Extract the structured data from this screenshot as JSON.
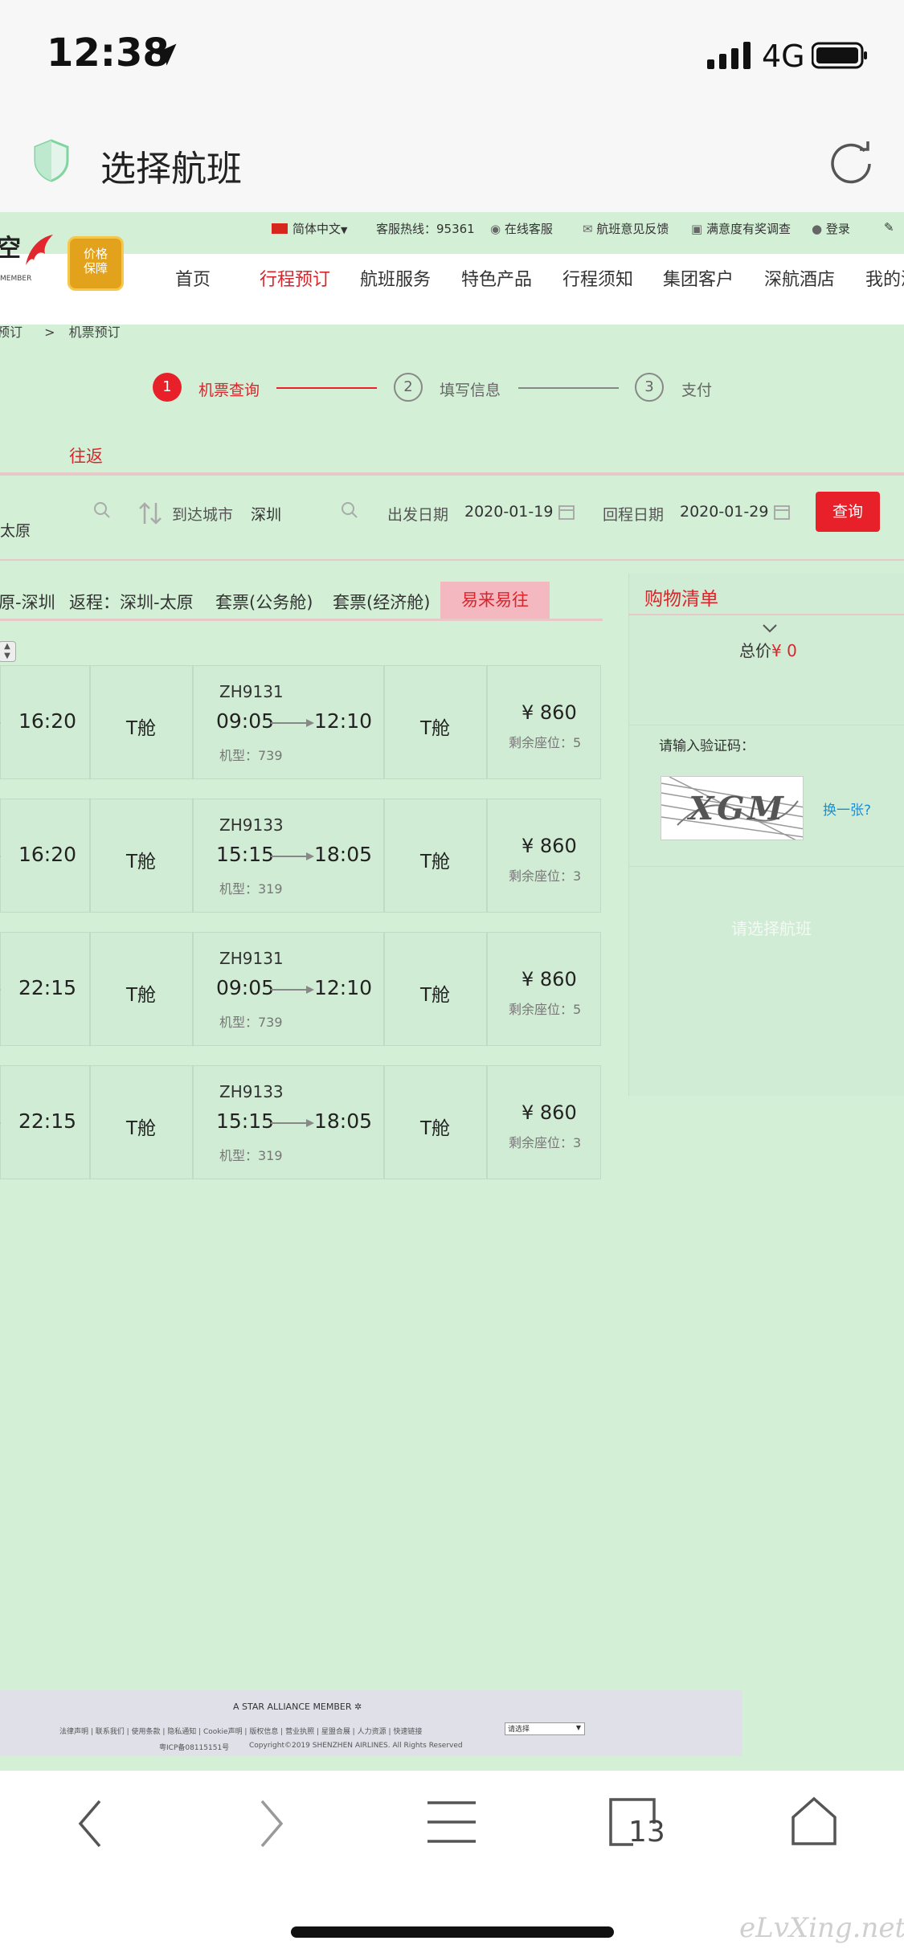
{
  "status_bar": {
    "time": "12:38",
    "network": "4G"
  },
  "browser": {
    "title": "选择航班"
  },
  "topbar": {
    "language": "简体中文",
    "hotline": "客服热线：95361",
    "online_service": "在线客服",
    "feedback": "航班意见反馈",
    "survey": "满意度有奖调查",
    "login": "登录"
  },
  "logo": {
    "partial_text": "空",
    "tag": "MEMBER",
    "badge": "价格\n保障"
  },
  "nav": [
    "首页",
    "行程预订",
    "航班服务",
    "特色产品",
    "行程须知",
    "集团客户",
    "深航酒店",
    "我的深"
  ],
  "breadcrumb": {
    "prev": "预订",
    "sep": ">",
    "current": "机票预订"
  },
  "steps": [
    {
      "num": "1",
      "label": "机票查询"
    },
    {
      "num": "2",
      "label": "填写信息"
    },
    {
      "num": "3",
      "label": "支付"
    }
  ],
  "trip_type": "往返",
  "search": {
    "from_city": "太原",
    "to_label": "到达城市",
    "to_city": "深圳",
    "depart_label": "出发日期",
    "depart_date": "2020-01-19",
    "return_label": "回程日期",
    "return_date": "2020-01-29",
    "search_button": "查询"
  },
  "tabs": [
    "原-深圳",
    "返程：深圳-太原",
    "套票(公务舱)",
    "套票(经济舱)",
    "易来易往"
  ],
  "flights": [
    {
      "prev_time": "16:20",
      "prev_cabin": "T舱",
      "flight_no": "ZH9131",
      "dep": "09:05",
      "arr": "12:10",
      "aircraft": "机型：739",
      "cabin": "T舱",
      "price": "¥ 860",
      "seats": "剩余座位：5"
    },
    {
      "prev_time": "16:20",
      "prev_cabin": "T舱",
      "flight_no": "ZH9133",
      "dep": "15:15",
      "arr": "18:05",
      "aircraft": "机型：319",
      "cabin": "T舱",
      "price": "¥ 860",
      "seats": "剩余座位：3"
    },
    {
      "prev_time": "22:15",
      "prev_cabin": "T舱",
      "flight_no": "ZH9131",
      "dep": "09:05",
      "arr": "12:10",
      "aircraft": "机型：739",
      "cabin": "T舱",
      "price": "¥ 860",
      "seats": "剩余座位：5"
    },
    {
      "prev_time": "22:15",
      "prev_cabin": "T舱",
      "flight_no": "ZH9133",
      "dep": "15:15",
      "arr": "18:05",
      "aircraft": "机型：319",
      "cabin": "T舱",
      "price": "¥ 860",
      "seats": "剩余座位：3"
    }
  ],
  "cart": {
    "title": "购物清单",
    "total_label": "总价",
    "total_value": "¥ 0",
    "captcha_label": "请输入验证码：",
    "captcha_text": "XGM",
    "refresh_captcha": "换一张?",
    "empty_hint": "请选择航班"
  },
  "footer": {
    "alliance": "A STAR ALLIANCE MEMBER",
    "links": "法律声明 | 联系我们 | 使用条款 | 隐私通知 | Cookie声明 | 版权信息 | 营业执照 | 星盟合展 | 人力资源 | 快速链接",
    "select": "请选择",
    "icp": "粤ICP备08115151号",
    "copyright": "Copyright©2019   SHENZHEN AIRLINES. All Rights Reserved"
  },
  "bottom_nav": {
    "tabs_count": "13"
  },
  "watermark": "eLvXing.net",
  "colors": {
    "accent": "#e8202a",
    "page_bg": "#d3efd6",
    "active_tab": "#f3b8c0",
    "link": "#1a8fd6"
  }
}
